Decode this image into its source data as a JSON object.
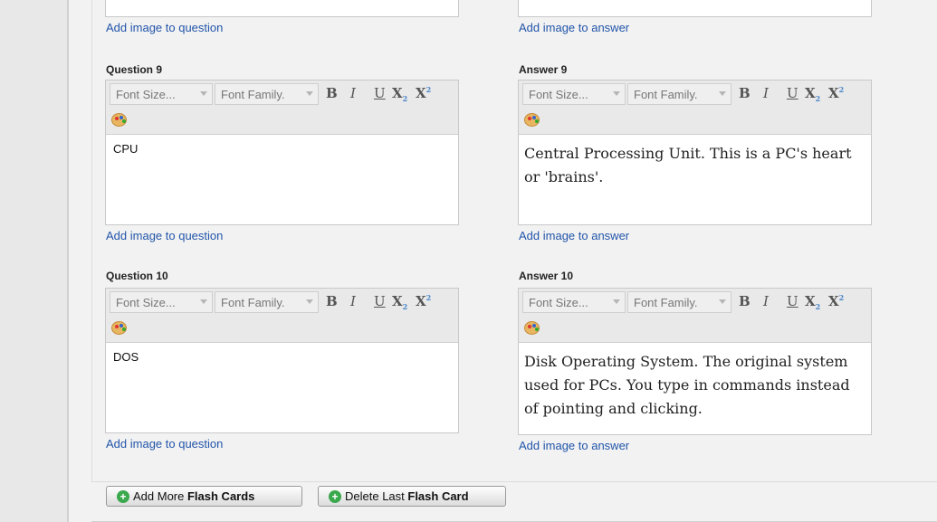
{
  "prev": {
    "question_link": "Add image to question",
    "answer_link": "Add image to answer"
  },
  "toolbar": {
    "font_size": "Font Size...",
    "font_family": "Font Family.",
    "bold": "B",
    "italic": "I",
    "underline": "U",
    "subscript": "X",
    "superscript": "X"
  },
  "cards": [
    {
      "question_label": "Question 9",
      "answer_label": "Answer 9",
      "question_text": "CPU",
      "answer_text": "Central Processing Unit. This is a PC's heart or 'brains'.",
      "question_link": "Add image to question",
      "answer_link": "Add image to answer"
    },
    {
      "question_label": "Question 10",
      "answer_label": "Answer 10",
      "question_text": "DOS",
      "answer_text": "Disk Operating System. The original system used for PCs. You type in commands instead of pointing and clicking.",
      "question_link": "Add image to question",
      "answer_link": "Add image to answer"
    }
  ],
  "buttons": {
    "add_prefix": "Add More ",
    "add_bold": "Flash Cards",
    "delete_prefix": "Delete Last ",
    "delete_bold": "Flash Card"
  },
  "icons": {
    "palette": "color-palette-icon",
    "add": "plus-circle-icon"
  },
  "colors": {
    "link": "#2255aa",
    "button_icon": "#3aa84c"
  }
}
